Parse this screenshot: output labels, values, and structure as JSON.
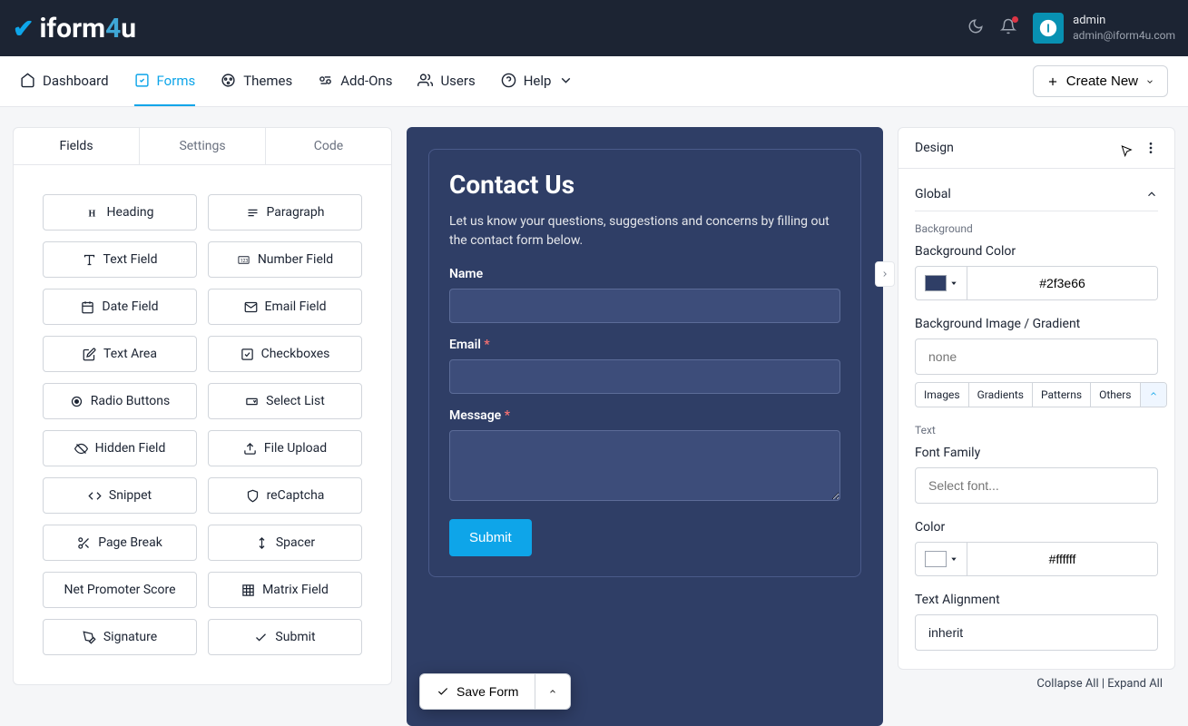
{
  "header": {
    "logo": "iform4u"
  },
  "user": {
    "name": "admin",
    "email": "admin@iform4u.com"
  },
  "nav": {
    "dashboard": "Dashboard",
    "forms": "Forms",
    "themes": "Themes",
    "addons": "Add-Ons",
    "users": "Users",
    "help": "Help",
    "create": "Create New"
  },
  "left": {
    "tabs": {
      "fields": "Fields",
      "settings": "Settings",
      "code": "Code"
    },
    "fields": {
      "heading": "Heading",
      "paragraph": "Paragraph",
      "textfield": "Text Field",
      "numberfield": "Number Field",
      "datefield": "Date Field",
      "emailfield": "Email Field",
      "textarea": "Text Area",
      "checkboxes": "Checkboxes",
      "radio": "Radio Buttons",
      "select": "Select List",
      "hidden": "Hidden Field",
      "fileupload": "File Upload",
      "snippet": "Snippet",
      "recaptcha": "reCaptcha",
      "pagebreak": "Page Break",
      "spacer": "Spacer",
      "nps": "Net Promoter Score",
      "matrix": "Matrix Field",
      "signature": "Signature",
      "submit": "Submit"
    }
  },
  "form": {
    "title": "Contact Us",
    "desc": "Let us know your questions, suggestions and concerns by filling out the contact form below.",
    "name_label": "Name",
    "email_label": "Email",
    "message_label": "Message",
    "submit": "Submit",
    "save": "Save Form"
  },
  "design": {
    "title": "Design",
    "global": "Global",
    "background_section": "Background",
    "bgcolor_label": "Background Color",
    "bgcolor_value": "#2f3e66",
    "bgimage_label": "Background Image / Gradient",
    "bgimage_placeholder": "none",
    "chips": {
      "images": "Images",
      "gradients": "Gradients",
      "patterns": "Patterns",
      "others": "Others"
    },
    "text_section": "Text",
    "font_label": "Font Family",
    "font_placeholder": "Select font...",
    "color_label": "Color",
    "color_value": "#ffffff",
    "align_label": "Text Alignment",
    "align_value": "inherit"
  },
  "footer": {
    "collapse": "Collapse All",
    "expand": "Expand All"
  }
}
